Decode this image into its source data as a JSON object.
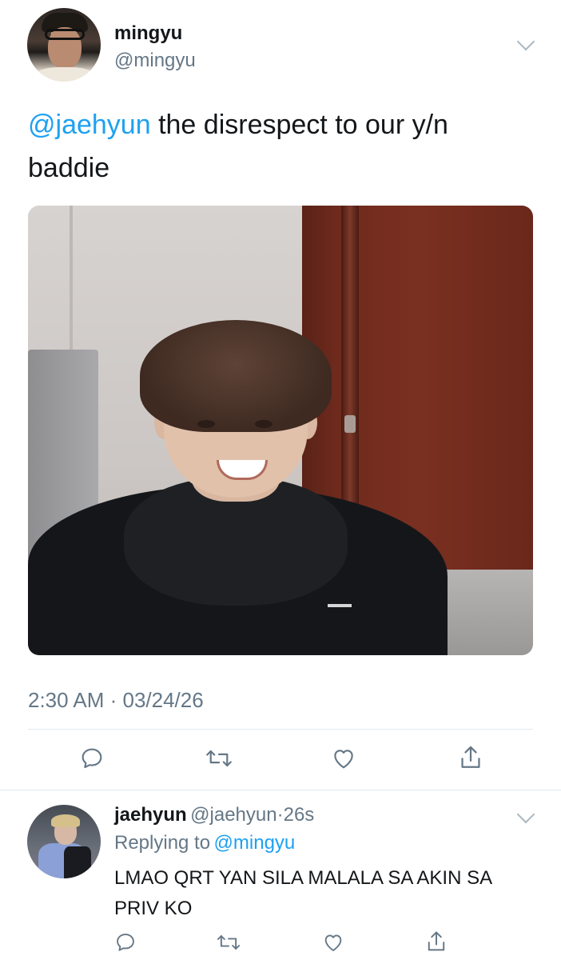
{
  "tweet": {
    "author_name": "mingyu",
    "author_handle": "@mingyu",
    "mention": "@jaehyun",
    "text_line1": "the disrespect to our y/n",
    "text_line2": "baddie",
    "timestamp": "2:30 AM · 03/24/26"
  },
  "actions": [
    "reply-icon",
    "retweet-icon",
    "like-icon",
    "share-icon"
  ],
  "reply": {
    "author_name": "jaehyun",
    "author_handle": "@jaehyun",
    "separator": "·",
    "age": "26s",
    "replying_prefix": "Replying to",
    "replying_to": "@mingyu",
    "text_line1": "LMAO QRT YAN SILA MALALA SA AKIN SA",
    "text_line2": "PRIV KO"
  },
  "colors": {
    "link": "#1da1f2",
    "secondary": "#657786",
    "divider": "#e1e8ed"
  }
}
